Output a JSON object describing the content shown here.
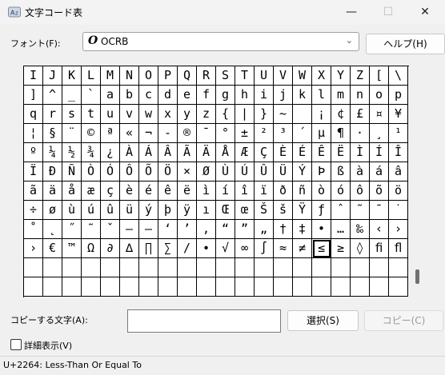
{
  "window": {
    "title": "文字コード表",
    "icon": "charmap-app-icon",
    "minimize": "—",
    "maximize": "☐",
    "close": "✕"
  },
  "font": {
    "label": "フォント(F):",
    "selected": "OCRB",
    "icon": "O",
    "dropdown_arrow": "⌄"
  },
  "help_button": "ヘルプ(H)",
  "grid": {
    "rows": [
      [
        "I",
        "J",
        "K",
        "L",
        "M",
        "N",
        "O",
        "P",
        "Q",
        "R",
        "S",
        "T",
        "U",
        "V",
        "W",
        "X",
        "Y",
        "Z",
        "[",
        "\\"
      ],
      [
        "]",
        "^",
        "_",
        "`",
        "a",
        "b",
        "c",
        "d",
        "e",
        "f",
        "g",
        "h",
        "i",
        "j",
        "k",
        "l",
        "m",
        "n",
        "o",
        "p"
      ],
      [
        "q",
        "r",
        "s",
        "t",
        "u",
        "v",
        "w",
        "x",
        "y",
        "z",
        "{",
        "|",
        "}",
        "~",
        " ",
        "¡",
        "¢",
        "£",
        "¤",
        "¥"
      ],
      [
        "¦",
        "§",
        "¨",
        "©",
        "ª",
        "«",
        "¬",
        "-",
        "®",
        "¯",
        "°",
        "±",
        "²",
        "³",
        "´",
        "µ",
        "¶",
        "·",
        "¸",
        "¹"
      ],
      [
        "º",
        "¼",
        "½",
        "¾",
        "¿",
        "À",
        "Á",
        "Â",
        "Ã",
        "Ä",
        "Å",
        "Æ",
        "Ç",
        "È",
        "É",
        "Ê",
        "Ë",
        "Ì",
        "Í",
        "Î"
      ],
      [
        "Ï",
        "Ð",
        "Ñ",
        "Ò",
        "Ó",
        "Ô",
        "Õ",
        "Ö",
        "×",
        "Ø",
        "Ù",
        "Ú",
        "Û",
        "Ü",
        "Ý",
        "Þ",
        "ß",
        "à",
        "á",
        "â"
      ],
      [
        "ã",
        "ä",
        "å",
        "æ",
        "ç",
        "è",
        "é",
        "ê",
        "ë",
        "ì",
        "í",
        "î",
        "ï",
        "ð",
        "ñ",
        "ò",
        "ó",
        "ô",
        "õ",
        "ö"
      ],
      [
        "÷",
        "ø",
        "ù",
        "ú",
        "û",
        "ü",
        "ý",
        "þ",
        "ÿ",
        "ı",
        "Œ",
        "œ",
        "Š",
        "š",
        "Ÿ",
        "ƒ",
        "ˆ",
        "˜",
        "¯",
        "˙"
      ],
      [
        "˚",
        "¸",
        "˝",
        "˛",
        "ˇ",
        "–",
        "—",
        "‘",
        "’",
        "‚",
        "“",
        "”",
        "„",
        "†",
        "‡",
        "•",
        "…",
        "‰",
        "‹",
        "›"
      ],
      [
        "€",
        "™",
        "Ω",
        "∂",
        "∆",
        "∏",
        "∑",
        "−",
        "/",
        "∙",
        "√",
        "∞",
        "∫",
        "≈",
        "≠",
        "≤",
        "≥",
        "◊",
        "ﬁ",
        "ﬂ"
      ]
    ],
    "visible_rows": [
      [
        "I",
        "J",
        "K",
        "L",
        "M",
        "N",
        "O",
        "P",
        "Q",
        "R",
        "S",
        "T",
        "U",
        "V",
        "W",
        "X",
        "Y",
        "Z",
        "[",
        "\\"
      ],
      [
        "]",
        "^",
        "_",
        "`",
        "a",
        "b",
        "c",
        "d",
        "e",
        "f",
        "g",
        "h",
        "i",
        "j",
        "k",
        "l",
        "m",
        "n",
        "o",
        "p"
      ],
      [
        "q",
        "r",
        "s",
        "t",
        "u",
        "v",
        "w",
        "x",
        "y",
        "z",
        "{",
        "|",
        "}",
        "~",
        " ",
        "¡",
        "¢",
        "£",
        "¤",
        "¥"
      ],
      [
        "¦",
        "§",
        "¨",
        "©",
        "ª",
        "«",
        "¬",
        "-",
        "®",
        "¯",
        "°",
        "±",
        "²",
        "³",
        "´",
        "µ",
        "¶",
        "·",
        "¸",
        "¹"
      ],
      [
        "º",
        "¼",
        "½",
        "¾",
        "¿",
        "À",
        "Á",
        "Â",
        "Ã",
        "Ä",
        "Å",
        "Æ",
        "Ç",
        "È",
        "É",
        "Ê",
        "Ë",
        "Ì",
        "Í",
        "Î"
      ],
      [
        "Ï",
        "Ð",
        "Ñ",
        "Ò",
        "Ó",
        "Ô",
        "Õ",
        "Ö",
        "×",
        "Ø",
        "Ù",
        "Ú",
        "Û",
        "Ü",
        "Ý",
        "Þ",
        "ß",
        "à",
        "á",
        "â"
      ],
      [
        "ã",
        "ä",
        "å",
        "æ",
        "ç",
        "è",
        "é",
        "ê",
        "ë",
        "ì",
        "í",
        "î",
        "ï",
        "ð",
        "ñ",
        "ò",
        "ó",
        "ô",
        "õ",
        "ö"
      ],
      [
        "÷",
        "ø",
        "ù",
        "ú",
        "û",
        "ü",
        "ý",
        "þ",
        "ÿ",
        "ı",
        "Œ",
        "œ",
        "Š",
        "š",
        "Ÿ",
        "ƒ",
        "ˆ",
        "˜",
        "¯",
        "˙"
      ],
      [
        "˚",
        "˛",
        "˝",
        "˜",
        "ˇ",
        "–",
        "—",
        "‘",
        "’",
        "‚",
        "“",
        "”",
        "„",
        "†",
        "‡",
        "•",
        "…",
        "‰",
        "‹",
        "›"
      ],
      [
        "›",
        "€",
        "™",
        "Ω",
        "∂",
        "∆",
        "∏",
        "∑",
        "/",
        "∙",
        "√",
        "∞",
        "∫",
        "≈",
        "≠",
        "≤",
        "≥",
        "◊",
        "ﬁ",
        "ﬂ"
      ]
    ],
    "selected_char": "≤"
  },
  "copy": {
    "label": "コピーする文字(A):",
    "value": "",
    "select_button": "選択(S)",
    "copy_button": "コピー(C)"
  },
  "advanced": {
    "label": "詳細表示(V)",
    "checked": false
  },
  "status": "U+2264: Less-Than Or Equal To"
}
